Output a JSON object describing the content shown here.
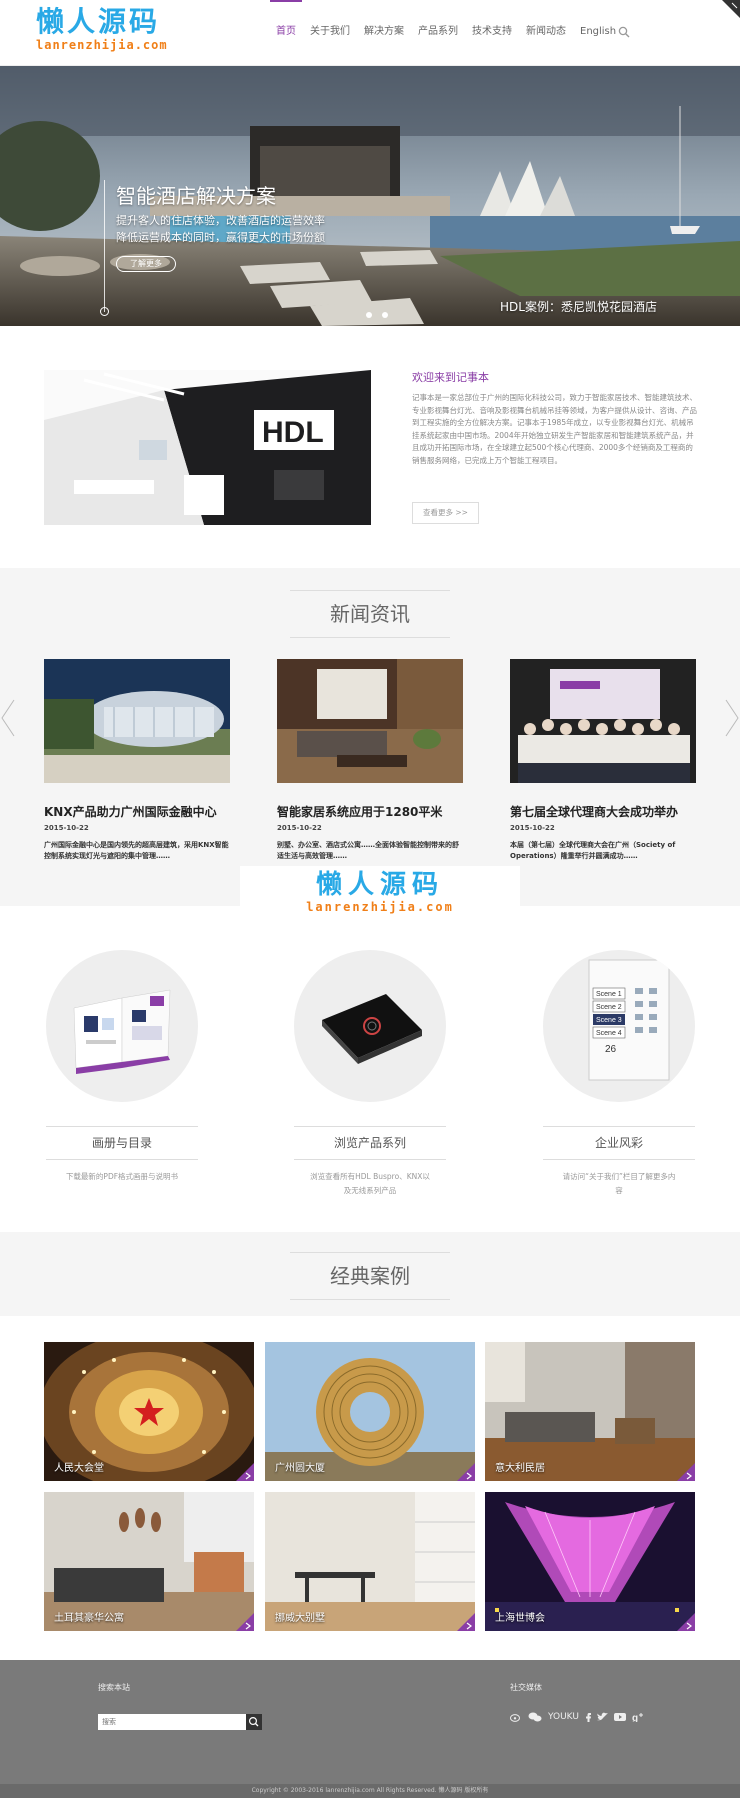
{
  "header": {
    "logo_cn": "懒人源码",
    "logo_en": "lanrenzhijia.com",
    "nav": [
      {
        "label": "首页"
      },
      {
        "label": "关于我们"
      },
      {
        "label": "解决方案"
      },
      {
        "label": "产品系列"
      },
      {
        "label": "技术支持"
      },
      {
        "label": "新闻动态"
      },
      {
        "label": "English"
      }
    ]
  },
  "hero": {
    "title": "智能酒店解决方案",
    "desc_line1": "提升客人的住店体验，改善酒店的运营效率",
    "desc_line2": "降低运营成本的同时，赢得更大的市场份额",
    "button": "了解更多",
    "caption": "HDL案例：悉尼凯悦花园酒店"
  },
  "about": {
    "title": "欢迎来到记事本",
    "text": "记事本是一家总部位于广州的国际化科技公司，致力于智能家居技术、智能建筑技术、专业影视舞台灯光、音响及影视舞台机械吊挂等领域，为客户提供从设计、咨询、产品到工程实施的全方位解决方案。记事本于1985年成立，以专业影视舞台灯光、机械吊挂系统起家由中国市场。2004年开始独立研发生产智能家居和智能建筑系统产品，并且成功开拓国际市场，在全球建立起500个核心代理商、2000多个经销商及工程商的销售服务网络，已完成上万个智能工程项目。",
    "more": "查看更多 >>"
  },
  "news": {
    "title": "新闻资讯",
    "items": [
      {
        "title": "KNX产品助力广州国际金融中心",
        "date": "2015-10-22",
        "summary": "广州国际金融中心是国内领先的超高层建筑，采用KNX智能控制系统实现灯光与遮阳的集中管理……"
      },
      {
        "title": "智能家居系统应用于1280平米",
        "date": "2015-10-22",
        "summary": "别墅、办公室、酒店式公寓……全面体验智能控制带来的舒适生活与高效管理……"
      },
      {
        "title": "第七届全球代理商大会成功举办",
        "date": "2015-10-22",
        "summary": "本届（第七届）全球代理商大会在广州（Society of Operations）隆重举行并圆满成功……"
      }
    ]
  },
  "watermark": {
    "cn": "懒人源码",
    "en": "lanrenzhijia.com"
  },
  "services": [
    {
      "title": "画册与目录",
      "desc": "下载最新的PDF格式画册与说明书"
    },
    {
      "title": "浏览产品系列",
      "desc": "浏览查看所有HDL Buspro、KNX以及无线系列产品"
    },
    {
      "title": "企业风彩",
      "desc": "请访问“关于我们”栏目了解更多内容"
    }
  ],
  "scene_panel": [
    "Scene 1",
    "Scene 2",
    "Scene 3",
    "Scene 4"
  ],
  "scene_temp": "26",
  "cases": {
    "title": "经典案例",
    "items": [
      {
        "label": "人民大会堂"
      },
      {
        "label": "广州圆大厦"
      },
      {
        "label": "意大利民居"
      },
      {
        "label": "土耳其豪华公寓"
      },
      {
        "label": "挪威大别墅"
      },
      {
        "label": "上海世博会"
      }
    ]
  },
  "footer": {
    "search_heading": "搜索本站",
    "search_placeholder": "搜索",
    "social_heading": "社交媒体",
    "youku": "YOUKU",
    "copyright": "Copyright © 2003-2016 lanrenzhijia.com All Rights Reserved. 懒人源码 版权所有"
  },
  "colors": {
    "accent": "#8a3ea6",
    "logo_blue": "#29a9e6",
    "logo_orange": "#f07f18",
    "footer": "#7a7a7a"
  }
}
